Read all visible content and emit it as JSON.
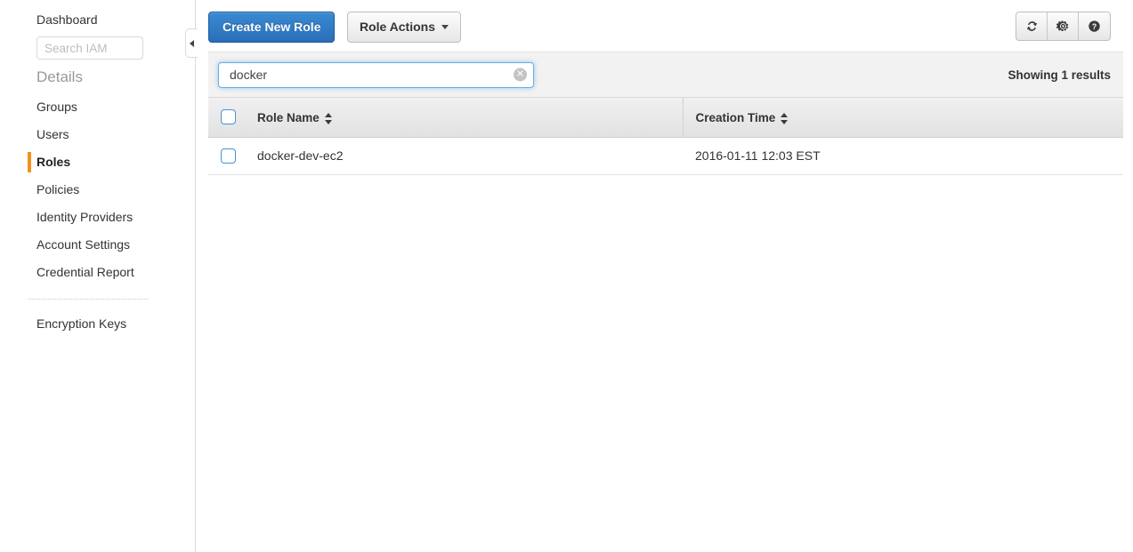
{
  "sidebar": {
    "dashboard_label": "Dashboard",
    "search": {
      "placeholder": "Search IAM",
      "value": ""
    },
    "section_title": "Details",
    "items": [
      {
        "label": "Groups",
        "active": false
      },
      {
        "label": "Users",
        "active": false
      },
      {
        "label": "Roles",
        "active": true
      },
      {
        "label": "Policies",
        "active": false
      },
      {
        "label": "Identity Providers",
        "active": false
      },
      {
        "label": "Account Settings",
        "active": false
      },
      {
        "label": "Credential Report",
        "active": false
      }
    ],
    "footer_items": [
      {
        "label": "Encryption Keys"
      }
    ],
    "active_accent_color": "#f0921e",
    "collapse_icon": "caret-left-icon"
  },
  "toolbar": {
    "create_role_label": "Create New Role",
    "role_actions_label": "Role Actions",
    "role_actions_caret": "chevron-down-icon",
    "icon_buttons": [
      {
        "name": "refresh-icon",
        "title": "Refresh"
      },
      {
        "name": "gear-icon",
        "title": "Settings"
      },
      {
        "name": "help-icon",
        "title": "Help"
      }
    ],
    "primary_color": "#2a6eb8"
  },
  "filterbar": {
    "search": {
      "value": "docker",
      "placeholder": "Search"
    },
    "clear_icon": "clear-circle-icon",
    "results_text": "Showing 1 results"
  },
  "table": {
    "select_all_checkbox": "unchecked",
    "columns": [
      {
        "label": "Role Name",
        "sortable": true
      },
      {
        "label": "Creation Time",
        "sortable": true
      }
    ],
    "rows": [
      {
        "selected": false,
        "role_name": "docker-dev-ec2",
        "creation_time": "2016-01-11 12:03 EST"
      }
    ]
  }
}
